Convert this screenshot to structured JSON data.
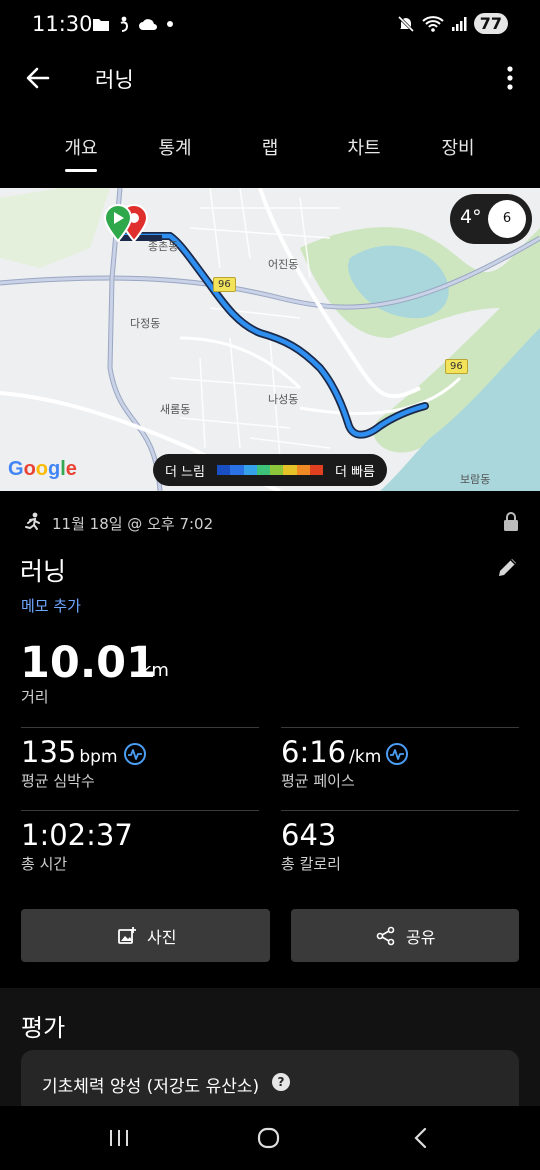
{
  "status_bar": {
    "time": "11:30",
    "battery": "77"
  },
  "app_bar": {
    "title": "러닝"
  },
  "tabs": [
    {
      "label": "개요",
      "active": true
    },
    {
      "label": "통계",
      "active": false
    },
    {
      "label": "랩",
      "active": false
    },
    {
      "label": "차트",
      "active": false
    },
    {
      "label": "장비",
      "active": false
    }
  ],
  "map": {
    "place_labels": [
      "종촌동",
      "어진동",
      "다정동",
      "새롬동",
      "나성동",
      "보람동"
    ],
    "road_number": "96",
    "weather": {
      "temp": "4°",
      "wind": "6"
    },
    "speed_legend": {
      "slow": "더 느림",
      "fast": "더 빠름",
      "colors": [
        "#1a4fc4",
        "#2b72e6",
        "#35a1e8",
        "#3ec27a",
        "#8cc63a",
        "#e6c229",
        "#f08a24",
        "#e0401f"
      ]
    },
    "attribution": "Google"
  },
  "activity": {
    "date": "11월 18일 @ 오후 7:02",
    "name": "러닝",
    "memo_link": "메모 추가"
  },
  "distance": {
    "value": "10.01",
    "unit": "km",
    "label": "거리"
  },
  "stats": {
    "heart_rate": {
      "value": "135",
      "unit": "bpm",
      "label": "평균 심박수"
    },
    "pace": {
      "value": "6:16",
      "unit": "/km",
      "label": "평균 페이스"
    },
    "time": {
      "value": "1:02:37",
      "label": "총 시간"
    },
    "calories": {
      "value": "643",
      "label": "총 칼로리"
    }
  },
  "actions": {
    "photo": "사진",
    "share": "공유"
  },
  "evaluation": {
    "title": "평가",
    "card_title": "기초체력 양성 (저강도 유산소)",
    "help": "?"
  },
  "colors": {
    "accent_link": "#6fa8ff",
    "route": "#2f8ff0",
    "start_marker": "#2ea84a",
    "end_marker": "#e0302e"
  }
}
